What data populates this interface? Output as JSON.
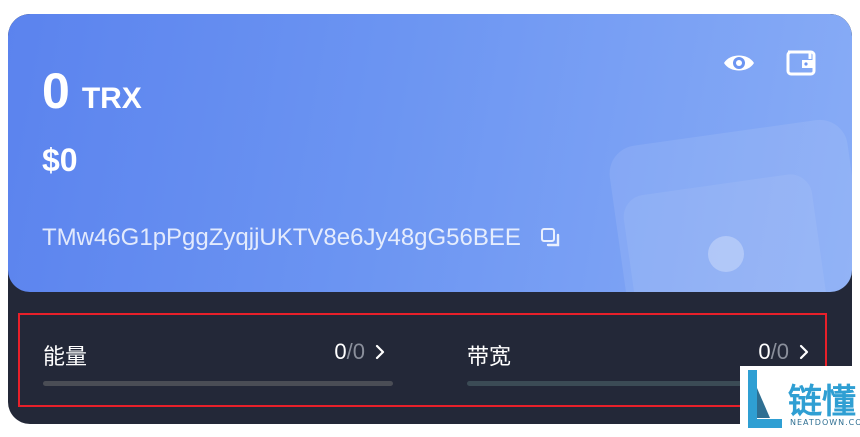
{
  "balance": {
    "amount": "0",
    "unit": "TRX",
    "fiat": "$0"
  },
  "address": "TMw46G1pPggZyqjjUKTV8e6Jy48gG56BEE",
  "icons": {
    "visibility": "eye-icon",
    "wallet": "wallet-icon",
    "copy": "copy-icon",
    "chevron": "chevron-right-icon"
  },
  "resources": [
    {
      "label": "能量",
      "used": "0",
      "separator": "/",
      "total": "0",
      "fill_percent": 0
    },
    {
      "label": "带宽",
      "used": "0",
      "separator": "/",
      "total": "0",
      "fill_percent": 0
    }
  ],
  "watermark": {
    "text": "链懂",
    "subtext": "NEATDOWN.COM"
  },
  "colors": {
    "card_gradient_start": "#5b83ee",
    "card_gradient_end": "#88acf6",
    "panel_background": "#232838",
    "highlight_border": "#e8202a"
  }
}
